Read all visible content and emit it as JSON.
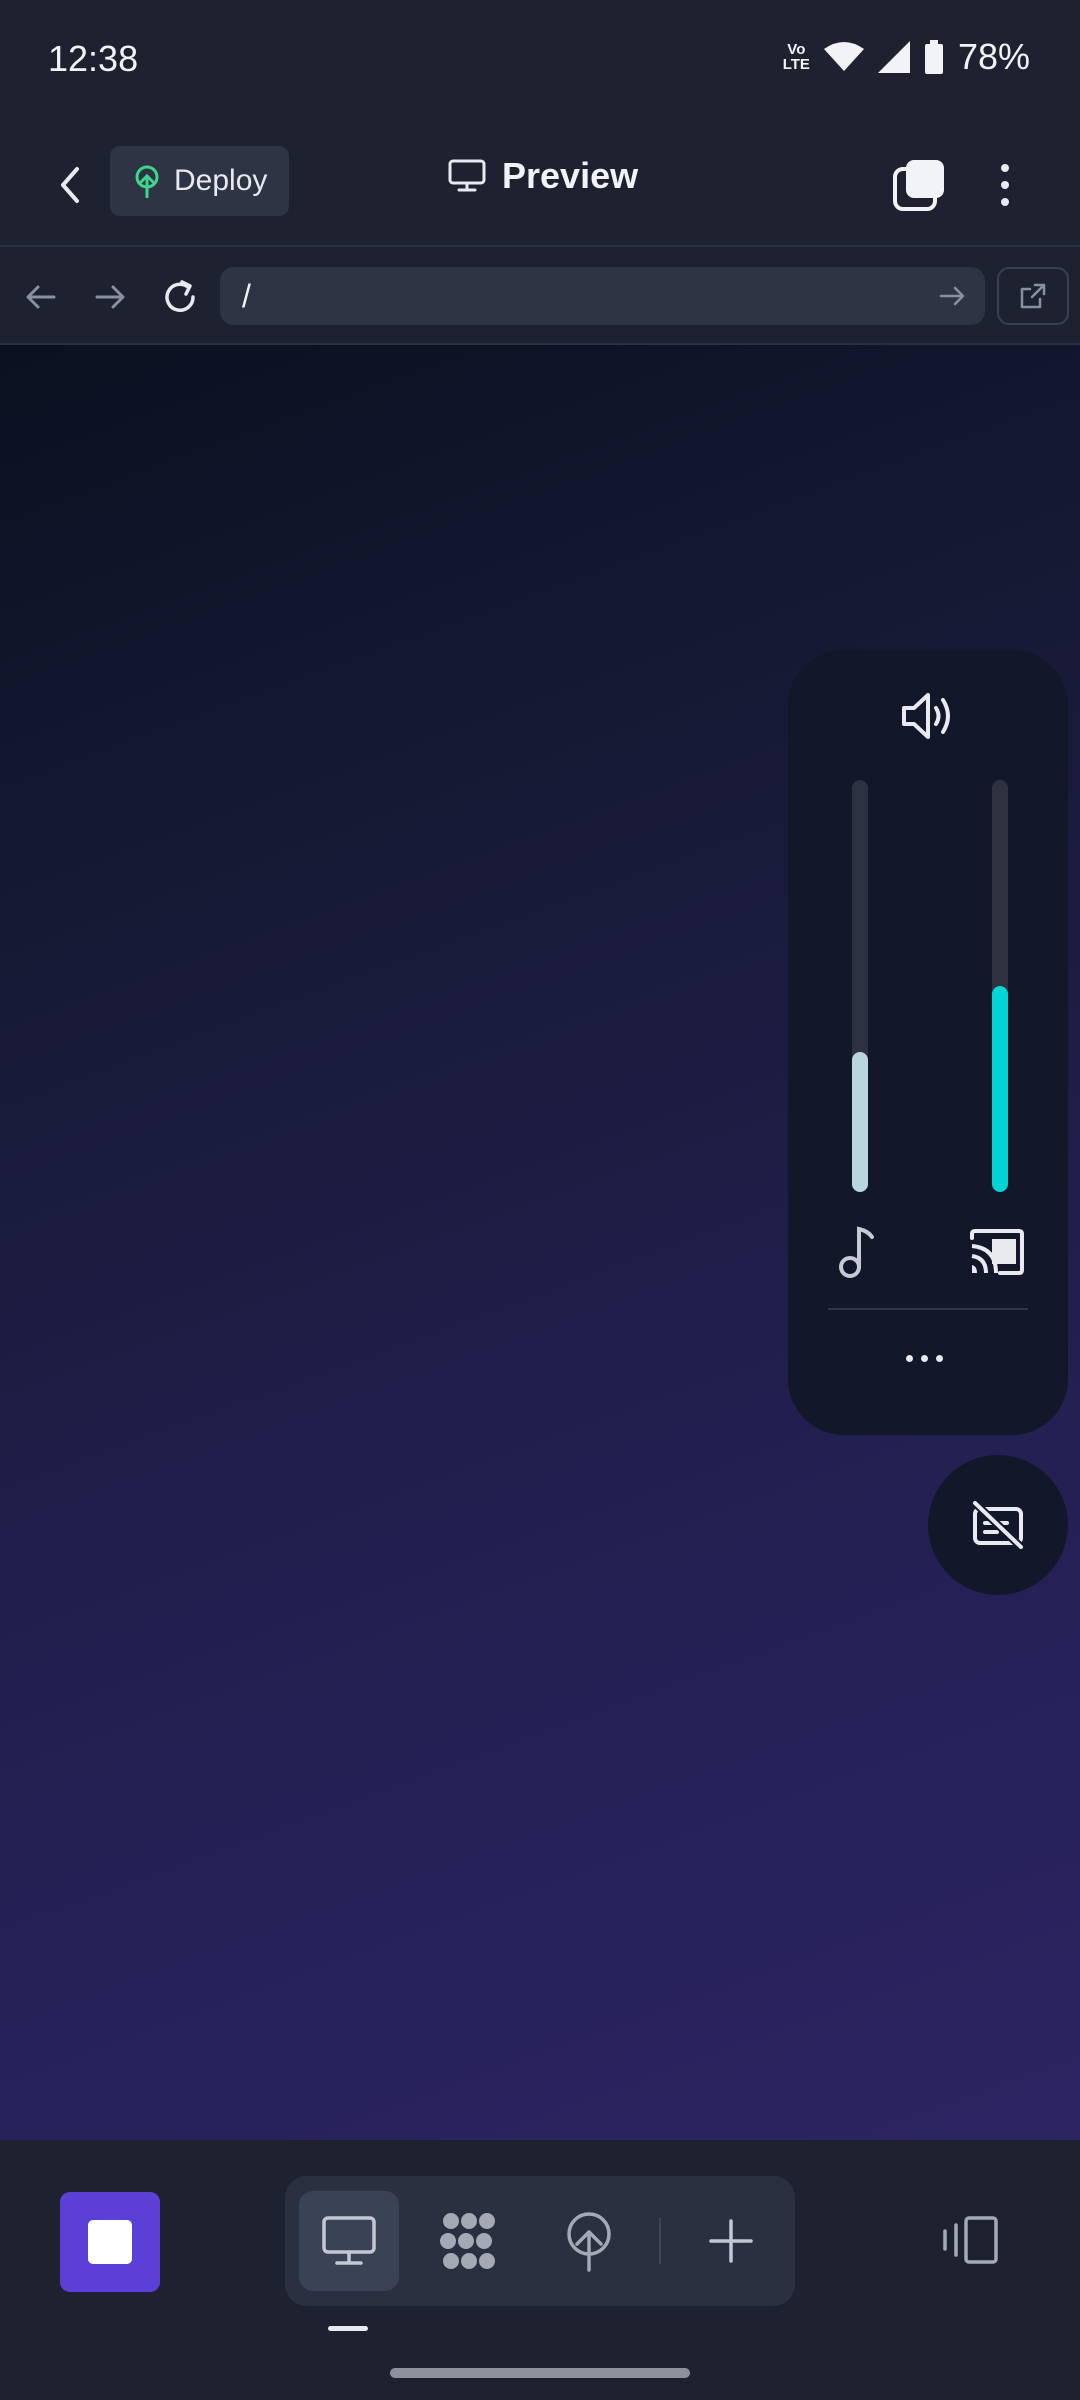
{
  "status": {
    "time": "12:38",
    "network_label": "Vo LTE",
    "battery": "78%"
  },
  "header": {
    "deploy_label": "Deploy",
    "title": "Preview"
  },
  "url_bar": {
    "value": "/"
  },
  "volume_panel": {
    "media_level": 0.34,
    "cast_level": 0.5,
    "accent": "#00d4d4",
    "media_color": "#b9d6dc"
  },
  "colors": {
    "stop_button": "#5b3fd6",
    "deploy_icon": "#3dd68c"
  },
  "icons": {
    "back": "chevron-left-icon",
    "deploy": "deploy-tree-icon",
    "preview": "monitor-icon",
    "tabs": "tabs-icon",
    "more": "more-vertical-icon",
    "reload": "reload-icon",
    "open_external": "external-link-icon",
    "speaker": "speaker-icon",
    "music": "music-note-icon",
    "cast": "cast-icon",
    "captions": "captions-off-icon",
    "stop": "stop-icon",
    "workspace_modes": [
      "monitor-icon",
      "hex-grid-icon",
      "deploy-icon",
      "plus-icon"
    ],
    "device_toggle": "device-rotate-icon"
  }
}
